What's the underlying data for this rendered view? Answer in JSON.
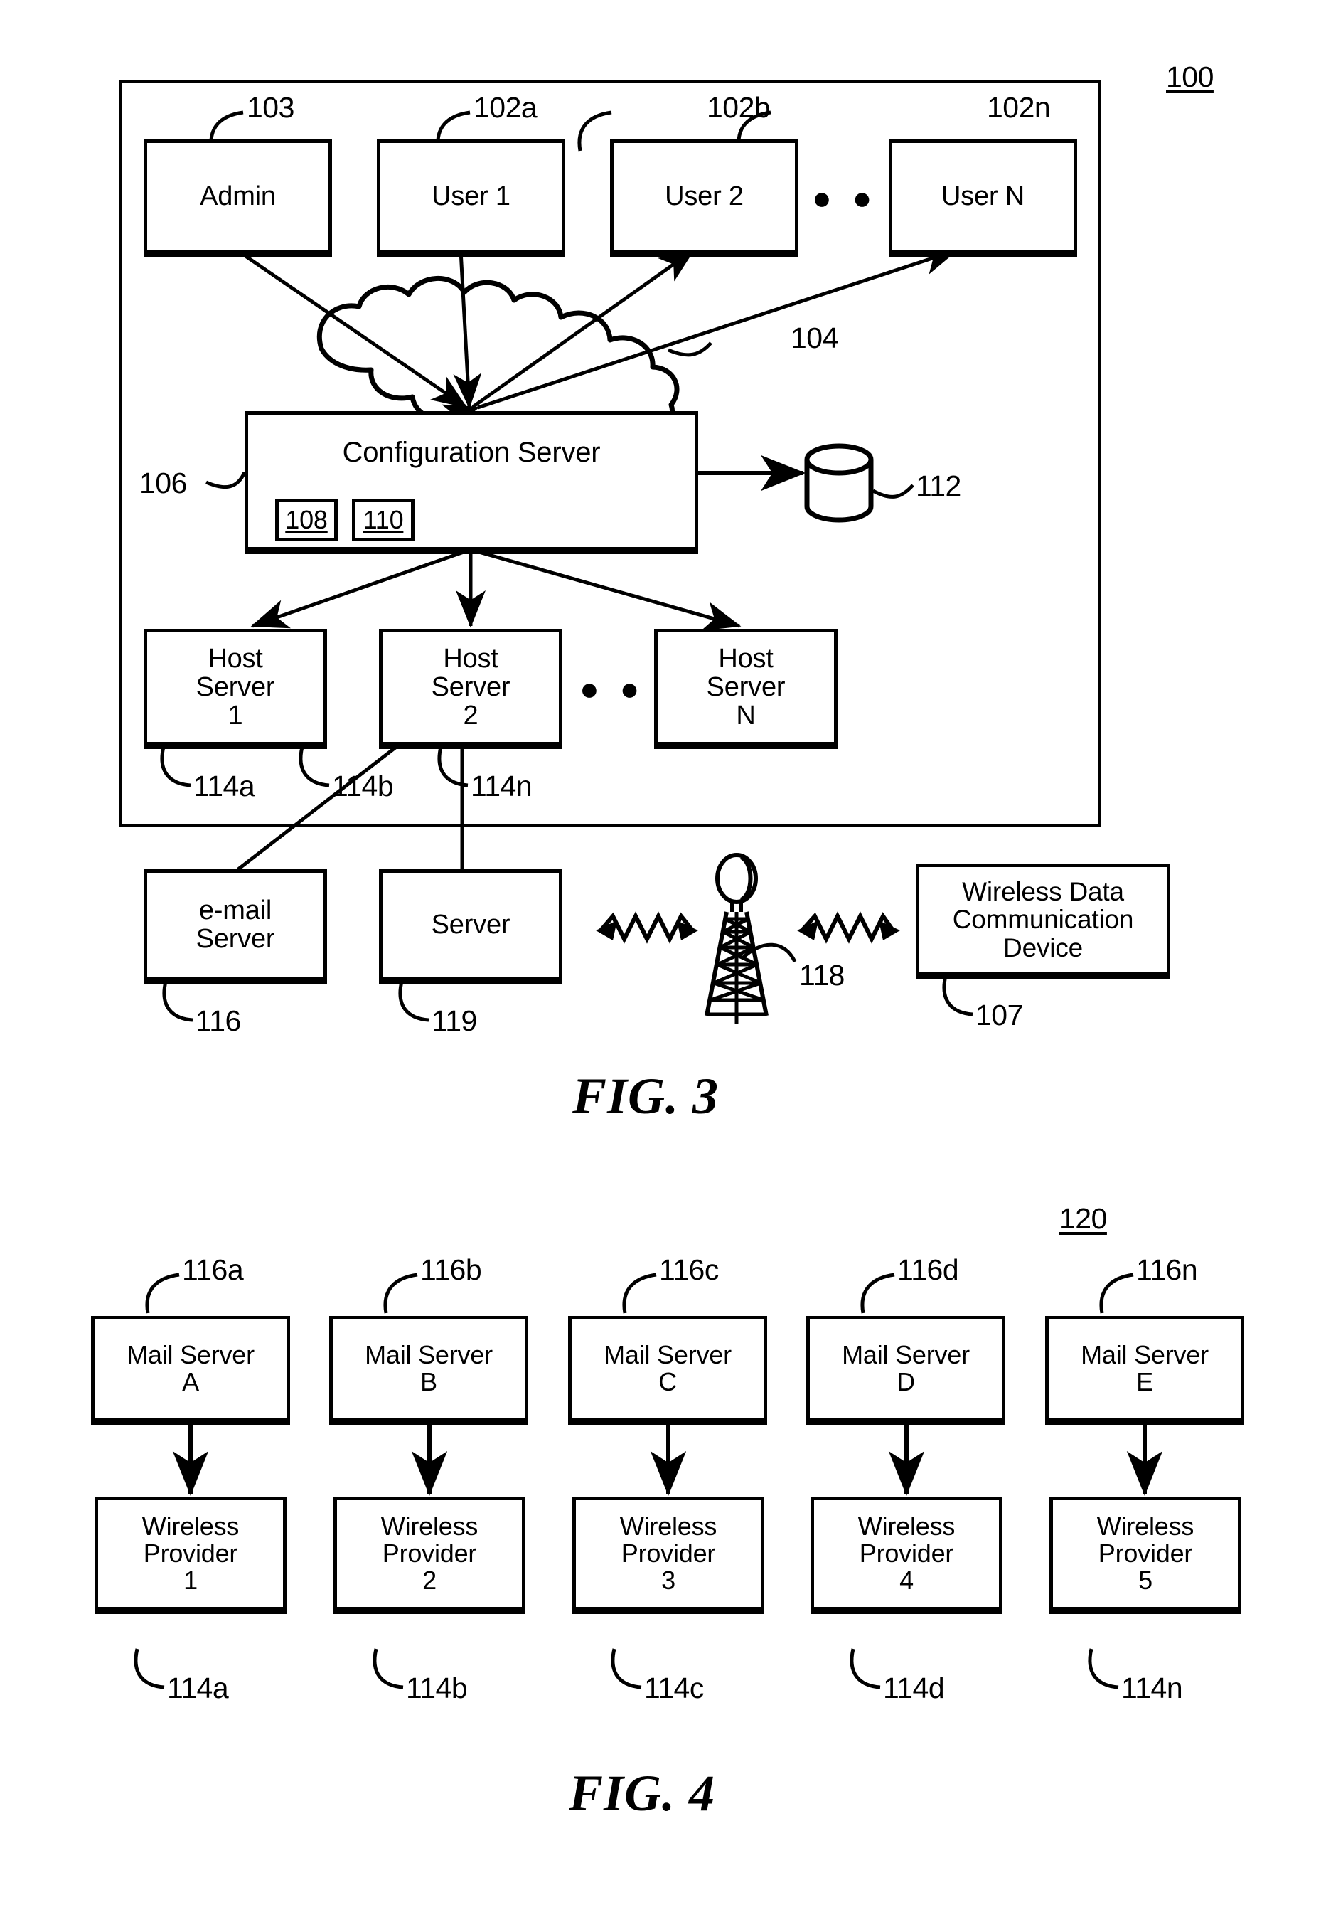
{
  "figures": [
    {
      "id": "fig3",
      "caption": "FIG. 3",
      "system_ref": "100",
      "nodes": {
        "admin": {
          "label": "Admin",
          "ref": "103"
        },
        "user1": {
          "label": "User 1",
          "ref": "102a"
        },
        "user2": {
          "label": "User 2",
          "ref": "102b"
        },
        "userN": {
          "label": "User N",
          "ref": "102n"
        },
        "network_cloud": {
          "label": "",
          "ref": "104"
        },
        "config_server": {
          "label": "Configuration Server",
          "ref": "106"
        },
        "config_module_1": {
          "label": "108"
        },
        "config_module_2": {
          "label": "110"
        },
        "database": {
          "label": "",
          "ref": "112"
        },
        "host1": {
          "label": "Host\nServer\n1",
          "ref": "114a"
        },
        "host2": {
          "label": "Host\nServer\n2",
          "ref": "114b"
        },
        "hostN": {
          "label": "Host\nServer\nN",
          "ref": "114n"
        },
        "email_server": {
          "label": "e-mail\nServer",
          "ref": "116"
        },
        "server": {
          "label": "Server",
          "ref": "119"
        },
        "tower": {
          "label": "",
          "ref": "118"
        },
        "wireless_device": {
          "label": "Wireless Data\nCommunication\nDevice",
          "ref": "107"
        }
      },
      "ellipsis": "● ● ●"
    },
    {
      "id": "fig4",
      "caption": "FIG. 4",
      "system_ref": "120",
      "mail_servers": [
        {
          "label": "Mail Server\nA",
          "ref": "116a"
        },
        {
          "label": "Mail Server\nB",
          "ref": "116b"
        },
        {
          "label": "Mail Server\nC",
          "ref": "116c"
        },
        {
          "label": "Mail Server\nD",
          "ref": "116d"
        },
        {
          "label": "Mail Server\nE",
          "ref": "116n"
        }
      ],
      "wireless_providers": [
        {
          "label": "Wireless\nProvider\n1",
          "ref": "114a"
        },
        {
          "label": "Wireless\nProvider\n2",
          "ref": "114b"
        },
        {
          "label": "Wireless\nProvider\n3",
          "ref": "114c"
        },
        {
          "label": "Wireless\nProvider\n4",
          "ref": "114d"
        },
        {
          "label": "Wireless\nProvider\n5",
          "ref": "114n"
        }
      ]
    }
  ],
  "colors": {
    "ink": "#000000",
    "paper": "#ffffff"
  }
}
